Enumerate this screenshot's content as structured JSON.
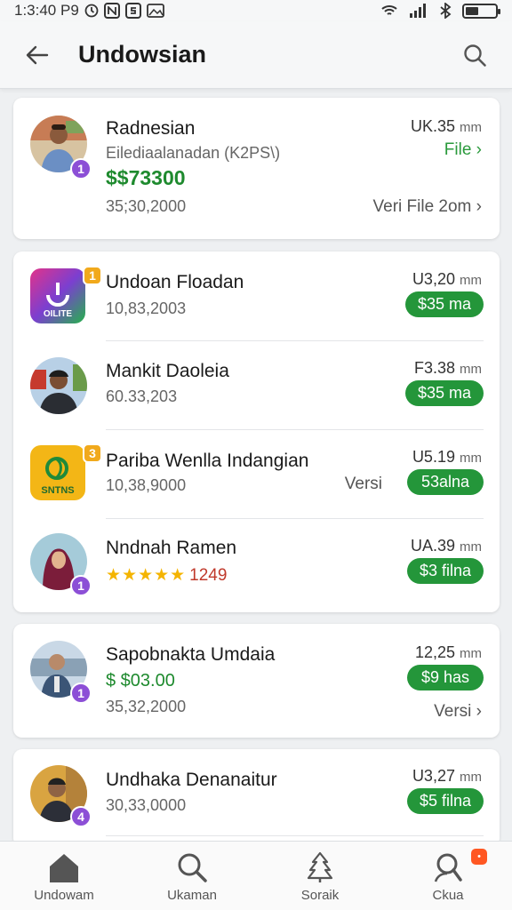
{
  "status_bar": {
    "time": "1:3:40 P9",
    "icons": [
      "timer-icon",
      "app-n-icon",
      "app-s-icon",
      "gallery-icon",
      "wifi-icon",
      "signal-icon",
      "bluetooth-icon",
      "battery-icon"
    ],
    "battery_level": 0.4
  },
  "app_bar": {
    "title": "Undowsian",
    "back_icon": "arrow-left-icon",
    "search_icon": "search-icon"
  },
  "colors": {
    "accent_green": "#24963a",
    "text_green": "#1e8a2e",
    "badge_purple": "#8c4fd6",
    "badge_orange": "#f1a91c",
    "star_yellow": "#f4b400",
    "rating_red": "#c0392b"
  },
  "featured": {
    "name": "Radnesian",
    "subtitle": "Eilediaalanadan (K2PS\\)",
    "amount": "$$73300",
    "date": "35;30,2000",
    "time": "UK.35",
    "time_unit": "mm",
    "file_link": "File",
    "veri_link": "Veri File 2om",
    "badge": "1"
  },
  "group1": [
    {
      "name": "Undoan Floadan",
      "sub": "10,83,2003",
      "time": "U3,20",
      "unit": "mm",
      "action": "$35 ma",
      "badge": "1",
      "kind": "app-purple"
    },
    {
      "name": "Mankit Daoleia",
      "sub": "60.33,203",
      "time": "F3.38",
      "unit": "mm",
      "action": "$35 ma",
      "badge": "",
      "kind": "person"
    },
    {
      "name": "Pariba Wenlla Indangian",
      "sub": "10,38,9000",
      "time": "U5.19",
      "unit": "mm",
      "action": "53alna",
      "versi": "Versi",
      "badge": "3",
      "kind": "app-yellow"
    },
    {
      "name": "Nndnah Ramen",
      "stars": "★★★★★",
      "rating": "1249",
      "time": "UA.39",
      "unit": "mm",
      "action": "$3 filna",
      "badge": "1",
      "kind": "person-hijab"
    }
  ],
  "icon_texts": {
    "app_purple": "OILITE",
    "app_yellow": "SNTNS"
  },
  "group2": {
    "name": "Sapobnakta Umdaia",
    "amount": "$ $03.00",
    "date": "35,32,2000",
    "time": "12,25",
    "unit": "mm",
    "action": "$9 has",
    "versi_link": "Versi",
    "badge": "1"
  },
  "group3": {
    "name": "Undhaka Denanaitur",
    "date": "30,33,0000",
    "time": "U3,27",
    "unit": "mm",
    "action": "$5 filna",
    "badge": "4"
  },
  "bottom_nav": [
    {
      "label": "Undowam",
      "icon": "home-icon"
    },
    {
      "label": "Ukaman",
      "icon": "search-icon"
    },
    {
      "label": "Soraik",
      "icon": "tree-icon"
    },
    {
      "label": "Ckua",
      "icon": "user-icon",
      "badge": "•"
    }
  ]
}
